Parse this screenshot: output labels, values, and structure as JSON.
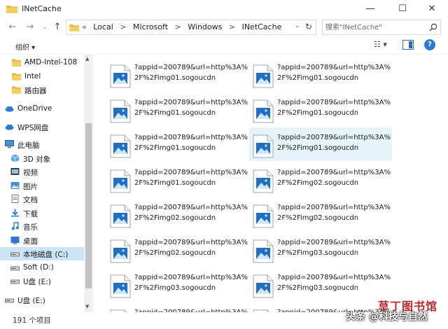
{
  "window": {
    "title": "INetCache",
    "minimize": "—",
    "maximize": "☐",
    "close": "✕"
  },
  "nav": {
    "back": "←",
    "forward": "→",
    "recent": "⌄",
    "up": "↑"
  },
  "address": {
    "overflow": "«",
    "crumbs": [
      "Local",
      "Microsoft",
      "Windows",
      "INetCache"
    ],
    "separator": ">",
    "dropdown": "⌄",
    "refresh": "↻"
  },
  "search": {
    "placeholder": "搜索\"INetCache\""
  },
  "toolbar": {
    "organize": "组织 ▾",
    "view": "☷ ▾",
    "help": "?"
  },
  "sidebar": {
    "items": [
      {
        "label": "AMD-Intel-108",
        "icon": "folder-icon"
      },
      {
        "label": "Intel",
        "icon": "folder-icon"
      },
      {
        "label": "路由器",
        "icon": "folder-icon"
      },
      {
        "label": "OneDrive",
        "icon": "cloud-icon"
      },
      {
        "label": "WPS网盘",
        "icon": "cloud-icon"
      },
      {
        "label": "此电脑",
        "icon": "computer-icon"
      },
      {
        "label": "3D 对象",
        "icon": "cube-icon"
      },
      {
        "label": "视频",
        "icon": "video-icon"
      },
      {
        "label": "图片",
        "icon": "pictures-icon"
      },
      {
        "label": "文档",
        "icon": "documents-icon"
      },
      {
        "label": "下载",
        "icon": "download-icon"
      },
      {
        "label": "音乐",
        "icon": "music-icon"
      },
      {
        "label": "桌面",
        "icon": "desktop-icon"
      },
      {
        "label": "本地磁盘 (C:)",
        "icon": "drive-icon"
      },
      {
        "label": "Soft (D:)",
        "icon": "drive-icon"
      },
      {
        "label": "U盘 (E:)",
        "icon": "drive-icon"
      },
      {
        "label": "U盘 (E:)",
        "icon": "drive-icon"
      }
    ]
  },
  "files": [
    {
      "line1": "?appid=200789&url=http%3A%",
      "line2": "2F%2Fimg01.sogoucdn"
    },
    {
      "line1": "?appid=200789&url=http%3A%",
      "line2": "2F%2Fimg01.sogoucdn"
    },
    {
      "line1": "?appid=200789&url=http%3A%",
      "line2": "2F%2Fimg01.sogoucdn"
    },
    {
      "line1": "?appid=200789&url=http%3A%",
      "line2": "2F%2Fimg01.sogoucdn"
    },
    {
      "line1": "?appid=200789&url=http%3A%",
      "line2": "2F%2Fimg01.sogoucdn"
    },
    {
      "line1": "?appid=200789&url=http%3A%",
      "line2": "2F%2Fimg01.sogoucdn"
    },
    {
      "line1": "?appid=200789&url=http%3A%",
      "line2": "2F%2Fimg01.sogoucdn"
    },
    {
      "line1": "?appid=200789&url=http%3A%",
      "line2": "2F%2Fimg02.sogoucdn"
    },
    {
      "line1": "?appid=200789&url=http%3A%",
      "line2": "2F%2Fimg02.sogoucdn"
    },
    {
      "line1": "?appid=200789&url=http%3A%",
      "line2": "2F%2Fimg02.sogoucdn"
    },
    {
      "line1": "?appid=200789&url=http%3A%",
      "line2": "2F%2Fimg02.sogoucdn"
    },
    {
      "line1": "?appid=200789&url=http%3A%",
      "line2": "2F%2Fimg03.sogoucdn"
    },
    {
      "line1": "?appid=200789&url=http%3A%",
      "line2": "2F%2Fimg03.sogoucdn"
    },
    {
      "line1": "?appid=200789&url=http%3A%",
      "line2": "2F%2Fimg03.sogoucdn"
    },
    {
      "line1": "?appid=200789&url=http%3A%",
      "line2": ""
    },
    {
      "line1": "?appid=200789&url=http%3A%",
      "line2": ""
    }
  ],
  "status": {
    "count": "191 个项目"
  },
  "watermark": {
    "line1": "草丁图书馆",
    "line2": "头条 @科技与自然"
  },
  "colors": {
    "selected": "#cce4f7",
    "hover": "#e5f3fb",
    "accent": "#2b7bd6"
  }
}
